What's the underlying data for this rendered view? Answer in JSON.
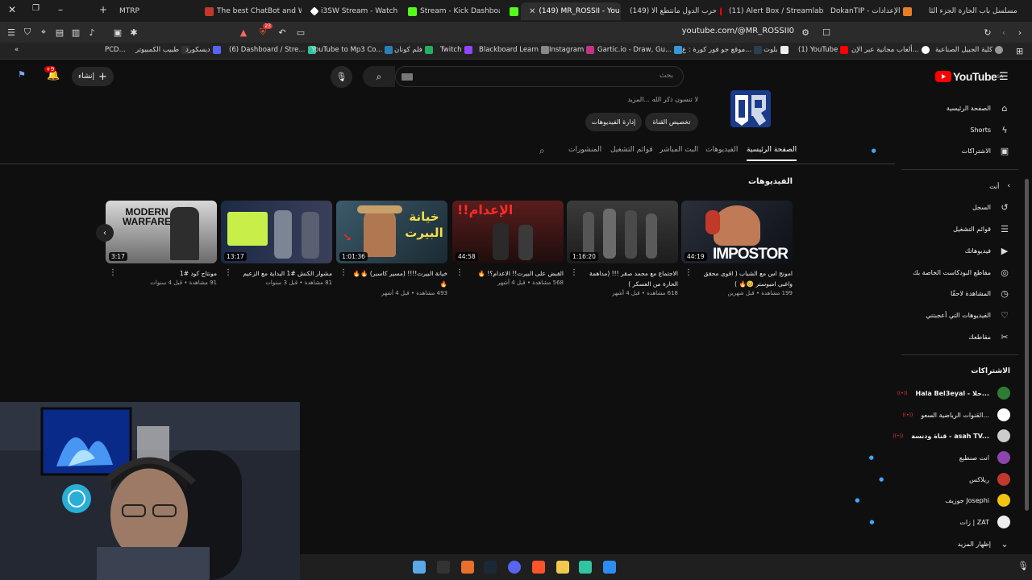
{
  "browser": {
    "tabs": [
      {
        "title": "MTRP",
        "color": "#444444"
      },
      {
        "title": "The best ChatBot and Wri",
        "color": "#c0392b"
      },
      {
        "title": "i3SW Stream - Watch Live",
        "color": "#ffffff"
      },
      {
        "title": "Stream - Kick Dashboard",
        "color": "#53fc18"
      },
      {
        "title": "(149) MR_ROSSII - You",
        "color": "#ff0000"
      },
      {
        "title": "(149) حرب الدول مانتطع الا",
        "color": "#ff0000"
      },
      {
        "title": "(11) Alert Box / Streamlabs",
        "color": "#31c3a2"
      },
      {
        "title": "DokanTIP - الإعدادات",
        "color": "#e67e22"
      },
      {
        "title": "مسلسل باب الحارة الجزء الثا",
        "color": "#ffffff"
      }
    ],
    "url": "youtube.com/@MR_ROSSII0",
    "shield_count": "23",
    "bookmarks": [
      "PCD...",
      "طبيب الكمبيوتر",
      "ديسكورد",
      "(6) Dashboard / Stre...",
      "YouTube to Mp3 Co...",
      "فلم كونان",
      "Twitch",
      "Blackboard Learn",
      "Instagram",
      "Gartic.io - Draw, Gu...",
      "موقع جو فور كورة : ع...",
      "بلوت",
      "(1) YouTube",
      "ألعاب مجانية عبر الإن...",
      "كلية الجبيل الصناعية"
    ]
  },
  "header": {
    "logo_text": "YouTube",
    "logo_region": "SA",
    "search_placeholder": "بحث",
    "create_label": "إنشاء",
    "notif_count": "+9"
  },
  "channel": {
    "description": "لا تنسون ذكر الله ...المزيد",
    "buttons": {
      "customize": "تخصيص القناة",
      "manage": "إدارة الفيديوهات"
    },
    "tabs": [
      "الصفحة الرئيسية",
      "الفيديوهات",
      "البث المباشر",
      "قوائم التشغيل",
      "المنشورات"
    ],
    "section_title": "الفيديوهات"
  },
  "videos": [
    {
      "title": "امونج اس مع الشباب ( اقوى محقق واغبى امبوستر 🥺🔥 )",
      "meta": "199 مشاهدة • قبل شهرين",
      "duration": "44:19",
      "thumb_text": "IMPOSTOR"
    },
    {
      "title": "الاجتماع مع محمد صقر !!! (مداهمة الحارة من العسكر )",
      "meta": "618 مشاهدة • قبل 4 أشهر",
      "duration": "1:16:20",
      "thumb_text": ""
    },
    {
      "title": "القبض على البيرت!! الاعدام؟! 🔥",
      "meta": "568 مشاهدة • قبل 4 أشهر",
      "duration": "44:58",
      "thumb_text": "الإعدام!!"
    },
    {
      "title": "خيانة البيرت!!!! (مسير كاسبر) 🔥🔥🔥",
      "meta": "493 مشاهدة • قبل 4 أشهر",
      "duration": "1:01:36",
      "thumb_text": "خيانة البيرت"
    },
    {
      "title": "مشوار الكنش #1 البداية مع الزعيم",
      "meta": "81 مشاهدة • قبل 3 سنوات",
      "duration": "13:17",
      "thumb_text": ""
    },
    {
      "title": "مونتاج كود #1",
      "meta": "91 مشاهدة • قبل 4 سنوات",
      "duration": "3:17",
      "thumb_text": "MODERN WARFARE"
    }
  ],
  "sidebar": {
    "main": [
      {
        "label": "الصفحة الرئيسية",
        "icon": "home-icon",
        "glyph": "⌂"
      },
      {
        "label": "Shorts",
        "icon": "shorts-icon",
        "glyph": "▶"
      },
      {
        "label": "الاشتراكات",
        "icon": "subscriptions-icon",
        "glyph": "▣"
      }
    ],
    "you_label": "أنت",
    "you": [
      {
        "label": "السجل",
        "icon": "history-icon",
        "glyph": "↺"
      },
      {
        "label": "قوائم التشغيل",
        "icon": "playlists-icon",
        "glyph": "☰"
      },
      {
        "label": "فيديوهاتك",
        "icon": "your-videos-icon",
        "glyph": "▶"
      },
      {
        "label": "مقاطع البودكاست الخاصة بك",
        "icon": "podcast-icon",
        "glyph": "◎"
      },
      {
        "label": "المشاهدة لاحقًا",
        "icon": "watch-later-icon",
        "glyph": "◷"
      },
      {
        "label": "الفيديوهات التي أعجبتني",
        "icon": "like-icon",
        "glyph": "👍"
      },
      {
        "label": "مقاطعك",
        "icon": "clips-icon",
        "glyph": "✂"
      }
    ],
    "subs_label": "الاشتراكات",
    "subs": [
      {
        "label": "Hala Bel3eyal - حلا...",
        "color": "#2e7d32",
        "live": true
      },
      {
        "label": "القنوات الرياضية السعو...",
        "color": "#ffffff",
        "live": true
      },
      {
        "label": "قناة ودنسة - asah TV...",
        "color": "#cccccc",
        "live": true
      },
      {
        "label": "انت صنطيع",
        "color": "#8e44ad",
        "live": false
      },
      {
        "label": "ريلاكس",
        "color": "#c0392b",
        "live": false
      },
      {
        "label": "جوزيف Josephi",
        "color": "#f1c40f",
        "live": false
      },
      {
        "label": "زات | ZAT",
        "color": "#eeeeee",
        "live": false
      }
    ],
    "show_more": "إظهار المزيد"
  }
}
